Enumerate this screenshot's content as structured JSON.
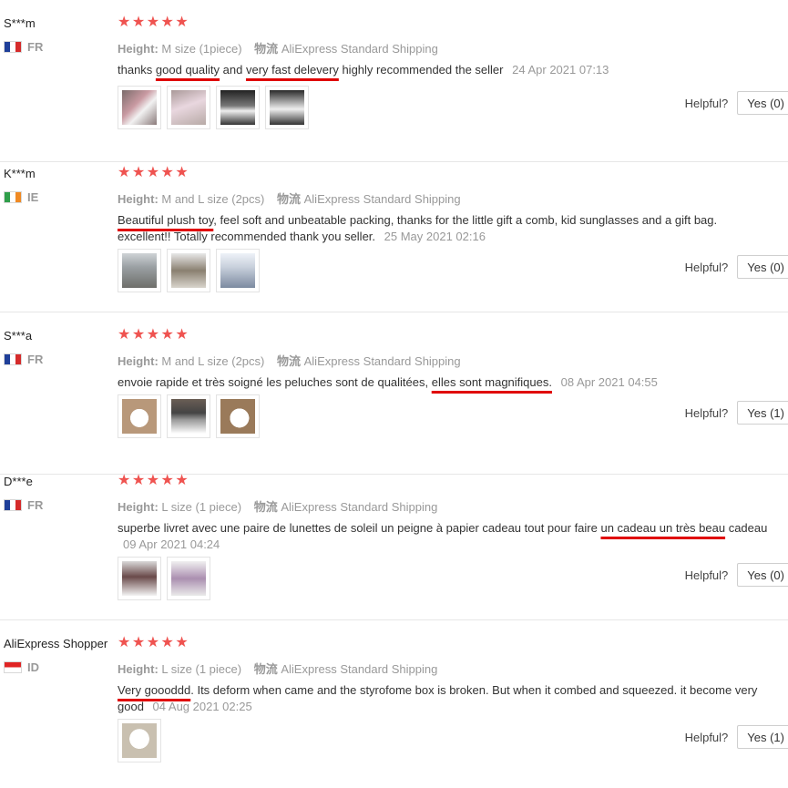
{
  "labels": {
    "height": "Height:",
    "shipping": "物流",
    "helpful": "Helpful?"
  },
  "stars": "★★★★★",
  "colors": {
    "star": "#ef5350",
    "underline": "#e00000"
  },
  "reviews": [
    {
      "user": "S***m",
      "country": "FR",
      "height_value": "M size (1piece)",
      "shipping": "AliExpress Standard Shipping",
      "text_parts": [
        "thanks ",
        "good quality",
        " and ",
        "very fast delevery",
        " highly recommended the seller"
      ],
      "date": "24 Apr 2021 07:13",
      "yes_label": "Yes (0)"
    },
    {
      "user": "K***m",
      "country": "IE",
      "height_value": "M and L size (2pcs)",
      "shipping": "AliExpress Standard Shipping",
      "text_parts": [
        "Beautiful plush toy",
        ", feel soft and unbeatable packing, thanks for the little gift a comb, kid sunglasses and a gift bag. excellent!! Totally recommended thank you seller."
      ],
      "date": "25 May 2021 02:16",
      "yes_label": "Yes (0)"
    },
    {
      "user": "S***a",
      "country": "FR",
      "height_value": "M and L size (2pcs)",
      "shipping": "AliExpress Standard Shipping",
      "text_parts": [
        "envoie rapide et très soigné les peluches sont de qualitées, ",
        "elles sont magnifiques."
      ],
      "date": "08 Apr 2021 04:55",
      "yes_label": "Yes (1)"
    },
    {
      "user": "D***e",
      "country": "FR",
      "height_value": "L size (1 piece)",
      "shipping": "AliExpress Standard Shipping",
      "text_parts": [
        "superbe livret avec une paire de lunettes de soleil un peigne à papier cadeau tout pour faire ",
        "un cadeau un très beau",
        " cadeau"
      ],
      "date": "09 Apr 2021 04:24",
      "yes_label": "Yes (0)"
    },
    {
      "user": "AliExpress Shopper",
      "country": "ID",
      "height_value": "L size (1 piece)",
      "shipping": "AliExpress Standard Shipping",
      "text_parts": [
        "Very goooddd",
        ". Its deform when came and the styrofome box is broken. But when it combed and squeezed. it become very good"
      ],
      "date": "04 Aug 2021 02:25",
      "yes_label": "Yes (1)"
    }
  ]
}
